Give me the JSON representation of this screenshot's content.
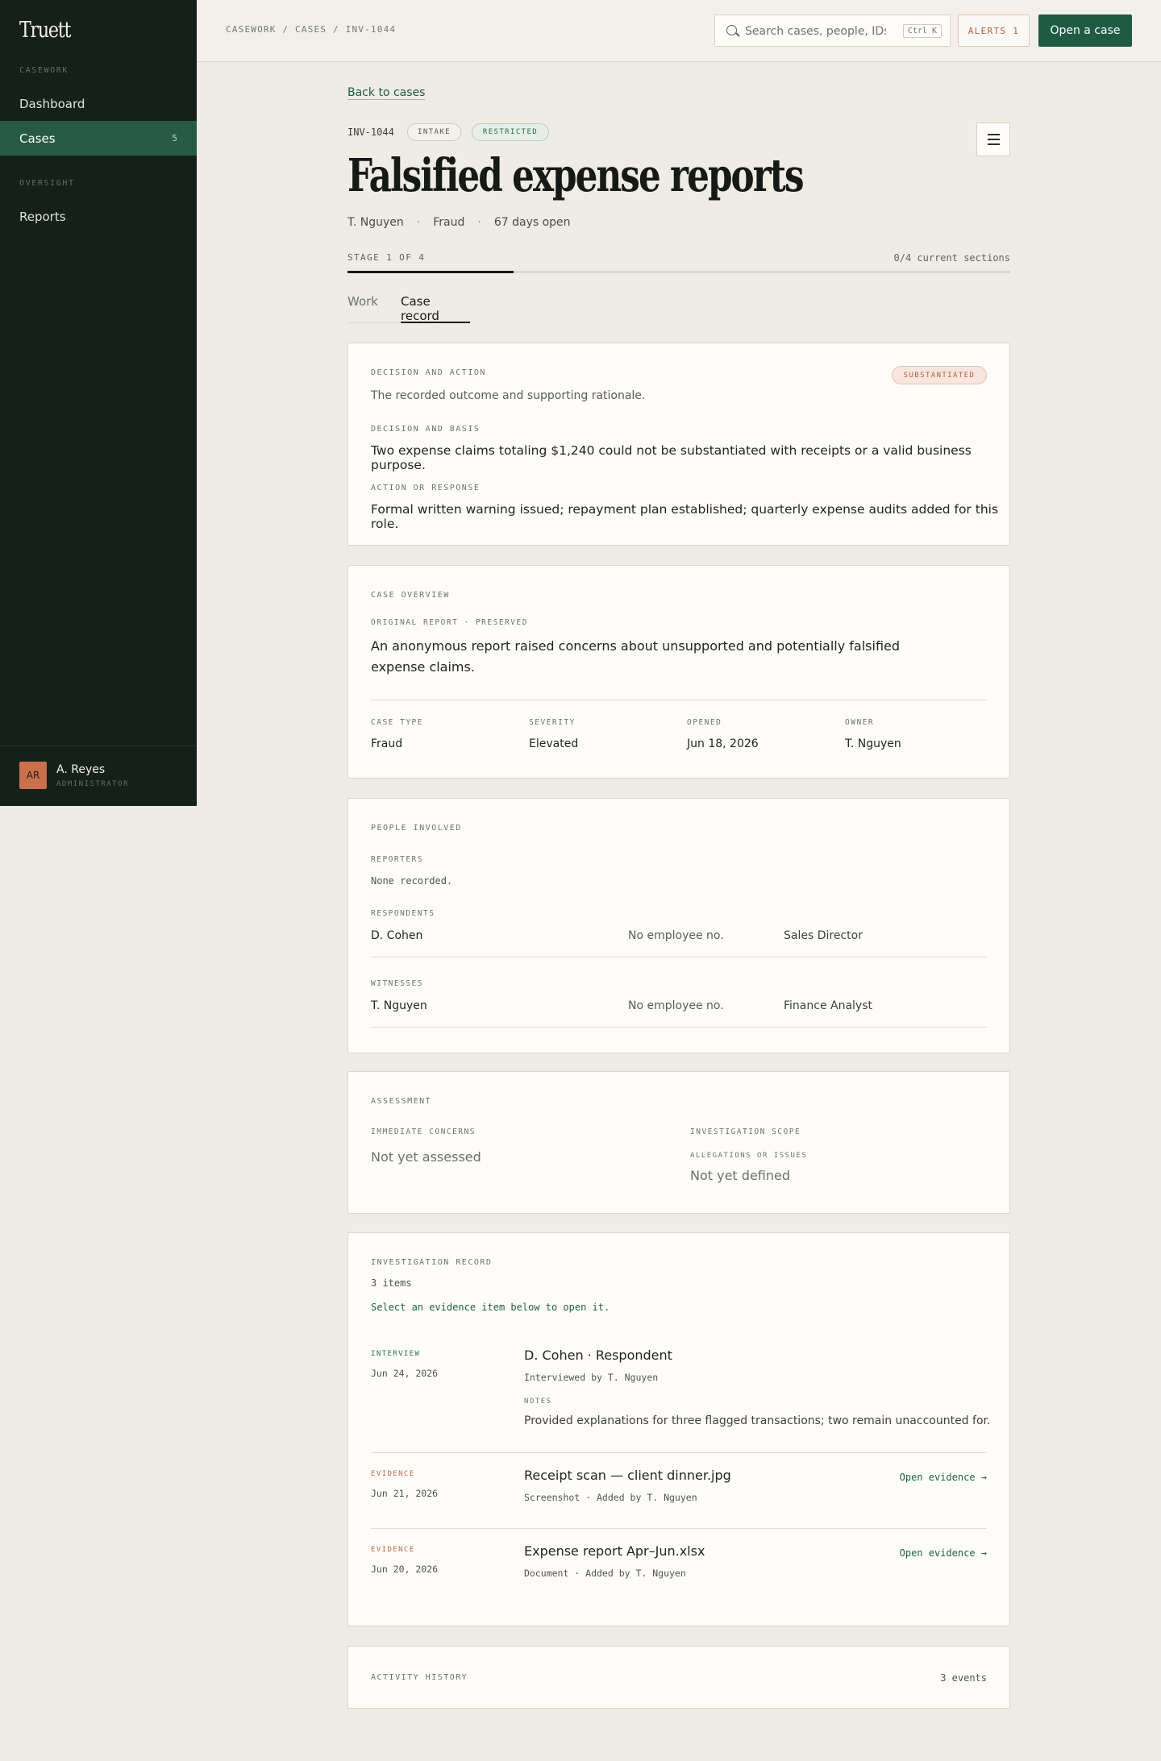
{
  "sidebar": {
    "logo": "Truett",
    "sections": [
      {
        "label": "CASEWORK",
        "items": [
          {
            "label": "Dashboard",
            "active": false,
            "count": ""
          },
          {
            "label": "Cases",
            "active": true,
            "count": "5"
          }
        ]
      },
      {
        "label": "OVERSIGHT",
        "items": [
          {
            "label": "Reports",
            "active": false,
            "count": ""
          }
        ]
      }
    ],
    "user": {
      "initials": "AR",
      "name": "A. Reyes",
      "role": "ADMINISTRATOR"
    }
  },
  "topbar": {
    "breadcrumb": "CASEWORK / CASES / INV-1044",
    "search": {
      "placeholder": "Search cases, people, IDs...",
      "value": "",
      "shortcut": "Ctrl K"
    },
    "alerts": {
      "label": "ALERTS",
      "count": "1"
    },
    "open_case_label": "Open a case"
  },
  "case": {
    "back_label": "Back to cases",
    "id": "INV-1044",
    "badges": [
      "INTAKE",
      "RESTRICTED"
    ],
    "title": "Falsified expense reports",
    "meta": [
      "T. Nguyen",
      "Fraud",
      "67 days open"
    ],
    "stage_label": "STAGE 1 OF 4",
    "stage_progress": 0.25,
    "sections_status": "0/4 current sections",
    "tabs": [
      {
        "label": "Work",
        "active": false
      },
      {
        "label": "Case record",
        "active": true
      }
    ]
  },
  "decision": {
    "heading": "DECISION AND ACTION",
    "subtitle": "The recorded outcome and supporting rationale.",
    "status_badge": "SUBSTANTIATED",
    "basis_label": "DECISION AND BASIS",
    "basis_text": "Two expense claims totaling $1,240 could not be substantiated with receipts or a valid business purpose.",
    "action_label": "ACTION OR RESPONSE",
    "action_text": "Formal written warning issued; repayment plan established; quarterly expense audits added for this role."
  },
  "overview": {
    "heading": "CASE OVERVIEW",
    "report_label": "ORIGINAL REPORT · PRESERVED",
    "report_line1": "An anonymous report raised concerns about unsupported and potentially falsified",
    "report_line2": "expense claims.",
    "fields": [
      {
        "label": "CASE TYPE",
        "value": "Fraud"
      },
      {
        "label": "SEVERITY",
        "value": "Elevated"
      },
      {
        "label": "OPENED",
        "value": "Jun 18, 2026"
      },
      {
        "label": "OWNER",
        "value": "T. Nguyen"
      }
    ]
  },
  "people": {
    "heading": "PEOPLE INVOLVED",
    "reporters_label": "REPORTERS",
    "reporters_empty": "None recorded.",
    "respondents_label": "RESPONDENTS",
    "respondents": [
      {
        "name": "D. Cohen",
        "employee_no": "No employee no.",
        "role": "Sales Director"
      }
    ],
    "witnesses_label": "WITNESSES",
    "witnesses": [
      {
        "name": "T. Nguyen",
        "employee_no": "No employee no.",
        "role": "Finance Analyst"
      }
    ]
  },
  "assessment": {
    "heading": "ASSESSMENT",
    "concerns_label": "IMMEDIATE CONCERNS",
    "concerns_value": "Not yet assessed",
    "scope_label": "INVESTIGATION SCOPE",
    "allegations_label": "ALLEGATIONS OR ISSUES",
    "allegations_value": "Not yet defined"
  },
  "record": {
    "heading": "INVESTIGATION RECORD",
    "count": "3 items",
    "hint": "Select an evidence item below to open it.",
    "items": [
      {
        "kind": "INTERVIEW",
        "date": "Jun 24, 2026",
        "title": "D. Cohen · Respondent",
        "detail": "Interviewed by T. Nguyen",
        "notes_label": "NOTES",
        "notes": "Provided explanations for three flagged transactions; two remain unaccounted for."
      },
      {
        "kind": "EVIDENCE",
        "date": "Jun 21, 2026",
        "title": "Receipt scan — client dinner.jpg",
        "detail": "Screenshot · Added by T. Nguyen",
        "open_label": "Open evidence →"
      },
      {
        "kind": "EVIDENCE",
        "date": "Jun 20, 2026",
        "title": "Expense report Apr–Jun.xlsx",
        "detail": "Document · Added by T. Nguyen",
        "open_label": "Open evidence →"
      }
    ]
  },
  "activity": {
    "heading": "ACTIVITY HISTORY",
    "count": "3 events"
  },
  "colors": {
    "sidebar_bg": "#15201b",
    "accent": "#1e5a44",
    "background": "#efebe5",
    "warning": "#b4603e"
  },
  "icons": {
    "search": "search-icon",
    "menu": "hamburger-menu-icon"
  }
}
